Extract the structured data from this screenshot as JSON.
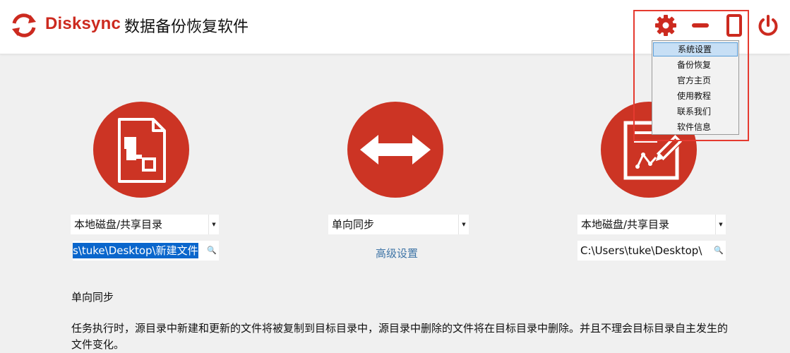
{
  "header": {
    "brand": "Disksync",
    "app_title": "数据备份恢复软件",
    "colors": {
      "accent": "#cc2a1f",
      "highlight_border": "#e53a2f"
    },
    "icons": [
      "sync-logo-icon",
      "gear-icon",
      "minimize-icon",
      "maximize-icon",
      "power-icon"
    ]
  },
  "menu": {
    "items": [
      {
        "label": "系统设置",
        "active": true
      },
      {
        "label": "备份恢复"
      },
      {
        "label": "官方主页"
      },
      {
        "label": "使用教程"
      },
      {
        "label": "联系我们"
      },
      {
        "label": "软件信息"
      }
    ]
  },
  "source": {
    "icon": "document-flowchart-icon",
    "type_select": "本地磁盘/共享目录",
    "path_value": "s\\tuke\\Desktop\\新建文件"
  },
  "middle": {
    "icon": "double-arrow-icon",
    "mode_select": "单向同步",
    "advanced_link": "高级设置"
  },
  "target": {
    "icon": "edit-document-icon",
    "type_select": "本地磁盘/共享目录",
    "path_value": "C:\\Users\\tuke\\Desktop\\"
  },
  "description": {
    "heading": "单向同步",
    "text": "任务执行时，源目录中新建和更新的文件将被复制到目标目录中，源目录中删除的文件将在目标目录中删除。并且不理会目标目录自主发生的文件变化。"
  },
  "symbols": {
    "search_icon": "🔍",
    "dropdown_arrow": "▼"
  }
}
